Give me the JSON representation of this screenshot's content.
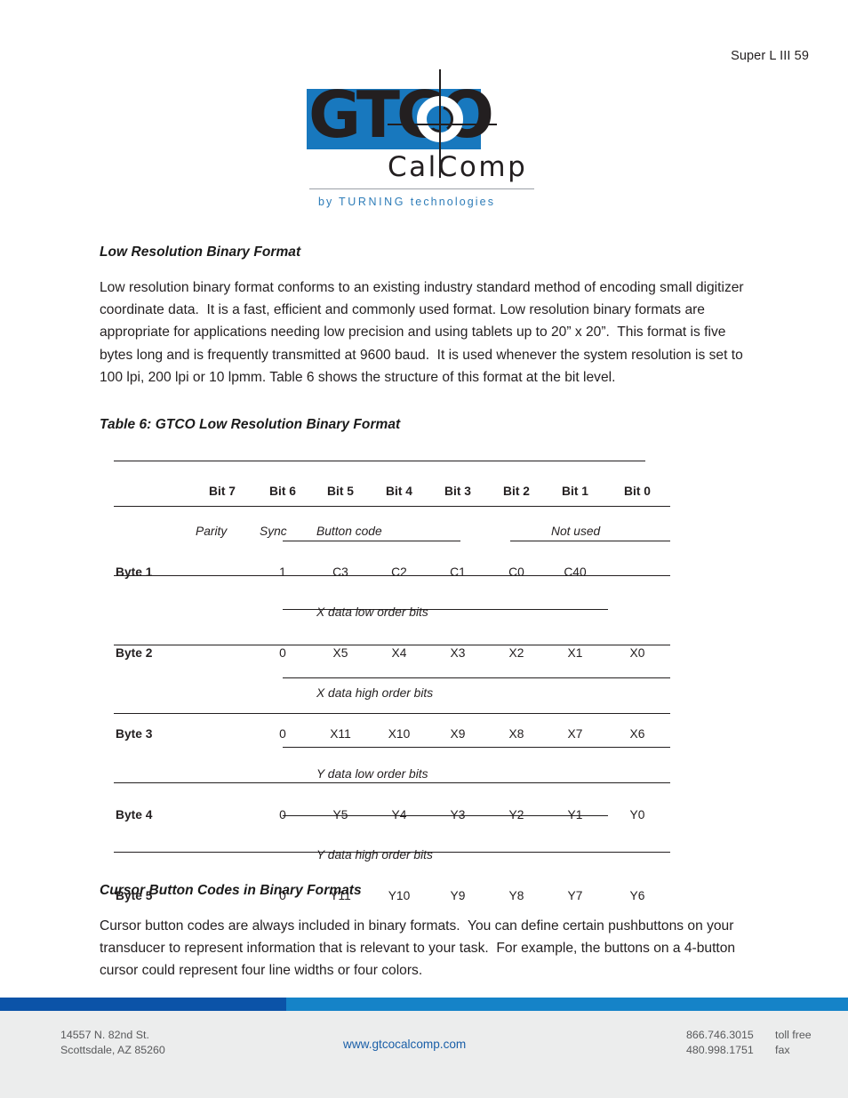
{
  "page": {
    "running_header": "Super L III 59"
  },
  "logo": {
    "wordmark": "GTCO",
    "subtitle": "CalComp",
    "tagline_prefix": "by ",
    "tagline_caps": "TURNING",
    "tagline_suffix": " technologies",
    "blue_hex": "#1878be",
    "tagline_hex": "#2d7cb8"
  },
  "sections": {
    "intro": {
      "heading": "Low Resolution Binary Format",
      "body": "Low resolution binary format conforms to an existing industry standard method of encoding small digitizer coordinate data.  It is a fast, efficient and commonly used format. Low resolution binary formats are appropriate for applications needing low precision and using tablets up to 20” x 20”.  This format is five bytes long and is frequently transmitted at 9600 baud.  It is used whenever the system resolution is set to 100 lpi, 200 lpi or 10 lpmm. Table 6 shows the structure of this format at the bit level."
    },
    "cursor": {
      "heading": "Cursor Button Codes in Binary Formats",
      "body": "Cursor button codes are always included in binary formats.  You can define certain pushbuttons on your transducer to represent information that is relevant to your task.  For example, the buttons on a 4-button cursor could represent four line widths or four colors."
    }
  },
  "table": {
    "caption": "Table 6: GTCO Low Resolution Binary Format",
    "columns": [
      "",
      "Bit 7",
      "Bit 6",
      "Bit 5",
      "Bit 4",
      "Bit 3",
      "Bit 2",
      "Bit 1",
      "Bit 0"
    ],
    "rows": [
      {
        "kind": "descriptor",
        "label": "",
        "bit7": "Parity",
        "bit6": "Sync",
        "bit5": "Button code",
        "bit1": "Not used"
      },
      {
        "kind": "data",
        "label": "Byte 1",
        "cells": [
          "1",
          "C3",
          "C2",
          "C1",
          "C0",
          "C40",
          ""
        ]
      },
      {
        "kind": "descriptor",
        "label": "",
        "bit5": "X data low order bits"
      },
      {
        "kind": "data",
        "label": "Byte 2",
        "cells": [
          "0",
          "X5",
          "X4",
          "X3",
          "X2",
          "X1",
          "X0"
        ]
      },
      {
        "kind": "descriptor",
        "label": "",
        "bit5": "X data high order bits"
      },
      {
        "kind": "data",
        "label": "Byte 3",
        "cells": [
          "0",
          "X11",
          "X10",
          "X9",
          "X8",
          "X7",
          "X6"
        ]
      },
      {
        "kind": "descriptor",
        "label": "",
        "bit5": "Y data low order bits"
      },
      {
        "kind": "data",
        "label": "Byte 4",
        "cells": [
          "0",
          "Y5",
          "Y4",
          "Y3",
          "Y2",
          "Y1",
          "Y0"
        ]
      },
      {
        "kind": "descriptor",
        "label": "",
        "bit5": "Y data high order bits"
      },
      {
        "kind": "data",
        "label": "Byte 5",
        "cells": [
          "0",
          "Y11",
          "Y10",
          "Y9",
          "Y8",
          "Y7",
          "Y6"
        ]
      }
    ]
  },
  "footer": {
    "address": "14557 N. 82nd St.\nScottsdale, AZ 85260",
    "url": "www.gtcocalcomp.com",
    "phones": "866.746.3015\n480.998.1751",
    "phone_labels": "toll free\nfax",
    "bar_dark_hex": "#0b53a8",
    "bar_light_hex": "#1583c8"
  }
}
